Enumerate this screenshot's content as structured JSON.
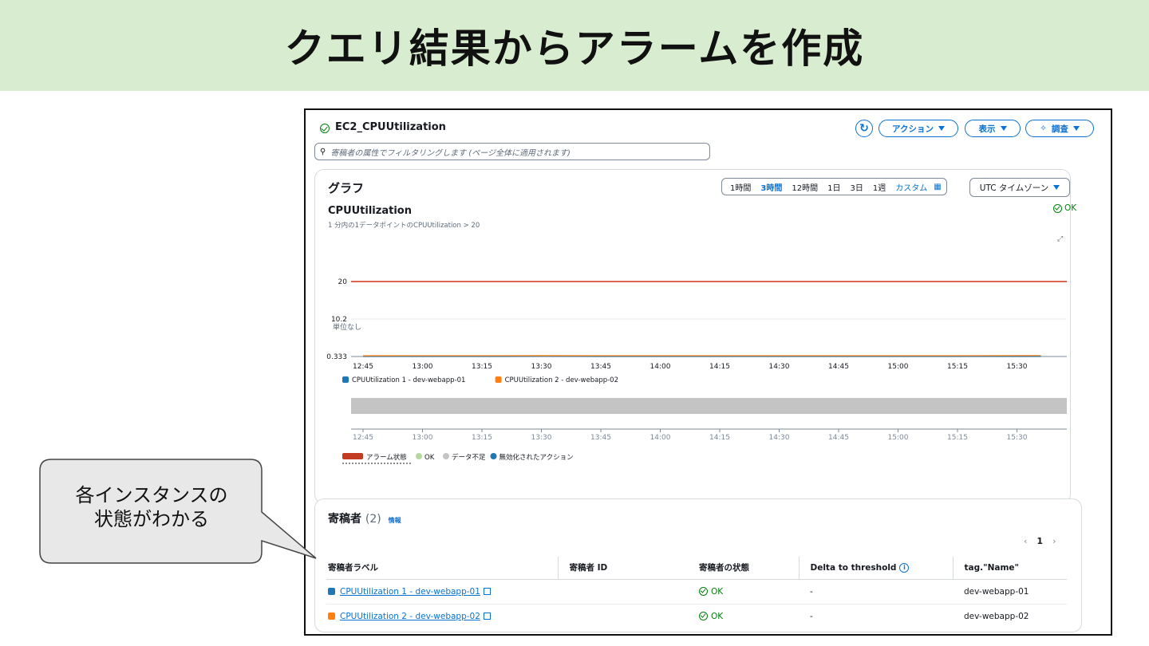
{
  "banner": {
    "title": "クエリ結果からアラームを作成"
  },
  "header": {
    "title": "EC2_CPUUtilization",
    "actions_label": "アクション",
    "view_label": "表示",
    "investigate_label": "調査"
  },
  "search": {
    "placeholder": "寄稿者の属性でフィルタリングします (ページ全体に適用されます)"
  },
  "graph": {
    "title": "グラフ",
    "ranges": [
      "1時間",
      "3時間",
      "12時間",
      "1日",
      "3日",
      "1週"
    ],
    "active_range": "3時間",
    "custom_label": "カスタム",
    "timezone_label": "UTC タイムゾーン",
    "chart_title": "CPUUtilization",
    "chart_subtitle": "1 分内の1データポイントのCPUUtilization > 20",
    "status": "OK",
    "unit_label": "単位なし"
  },
  "chart_data": {
    "type": "line",
    "x": [
      "12:45",
      "13:00",
      "13:15",
      "13:30",
      "13:45",
      "14:00",
      "14:15",
      "14:30",
      "14:45",
      "15:00",
      "15:15",
      "15:30"
    ],
    "yticks": [
      "20",
      "10.2",
      "0.333"
    ],
    "ylim": [
      0.333,
      20
    ],
    "threshold": 20,
    "threshold_color": "#d13212",
    "series": [
      {
        "name": "CPUUtilization 1 - dev-webapp-01",
        "color": "#1f77b4",
        "values": [
          0.333,
          0.35,
          0.34,
          0.36,
          0.35,
          0.34,
          0.35,
          0.34,
          0.35,
          0.34,
          0.35,
          0.34
        ]
      },
      {
        "name": "CPUUtilization 2 - dev-webapp-02",
        "color": "#ff7f0e",
        "values": [
          0.4,
          0.42,
          0.41,
          0.43,
          0.42,
          0.41,
          0.42,
          0.41,
          0.42,
          0.41,
          0.42,
          0.45
        ]
      }
    ],
    "state_legend": [
      {
        "label": "アラーム状態",
        "color": "#c23b22"
      },
      {
        "label": "OK",
        "color": "#b5d99c"
      },
      {
        "label": "データ不足",
        "color": "#c4c4c4"
      },
      {
        "label": "無効化されたアクション",
        "color": "#1f77b4"
      }
    ]
  },
  "contributors": {
    "title": "寄稿者",
    "count": "(2)",
    "info_label": "情報",
    "page": "1",
    "columns": [
      "寄稿者ラベル",
      "寄稿者 ID",
      "寄稿者の状態",
      "Delta to threshold",
      "tag.\"Name\""
    ],
    "rows": [
      {
        "label": "CPUUtilization 1 - dev-webapp-01",
        "id": "",
        "state": "OK",
        "delta": "-",
        "name": "dev-webapp-01",
        "color": "#1f77b4"
      },
      {
        "label": "CPUUtilization 2 - dev-webapp-02",
        "id": "",
        "state": "OK",
        "delta": "-",
        "name": "dev-webapp-02",
        "color": "#ff7f0e"
      }
    ]
  },
  "callout": {
    "line1": "各インスタンスの",
    "line2": "状態がわかる"
  }
}
